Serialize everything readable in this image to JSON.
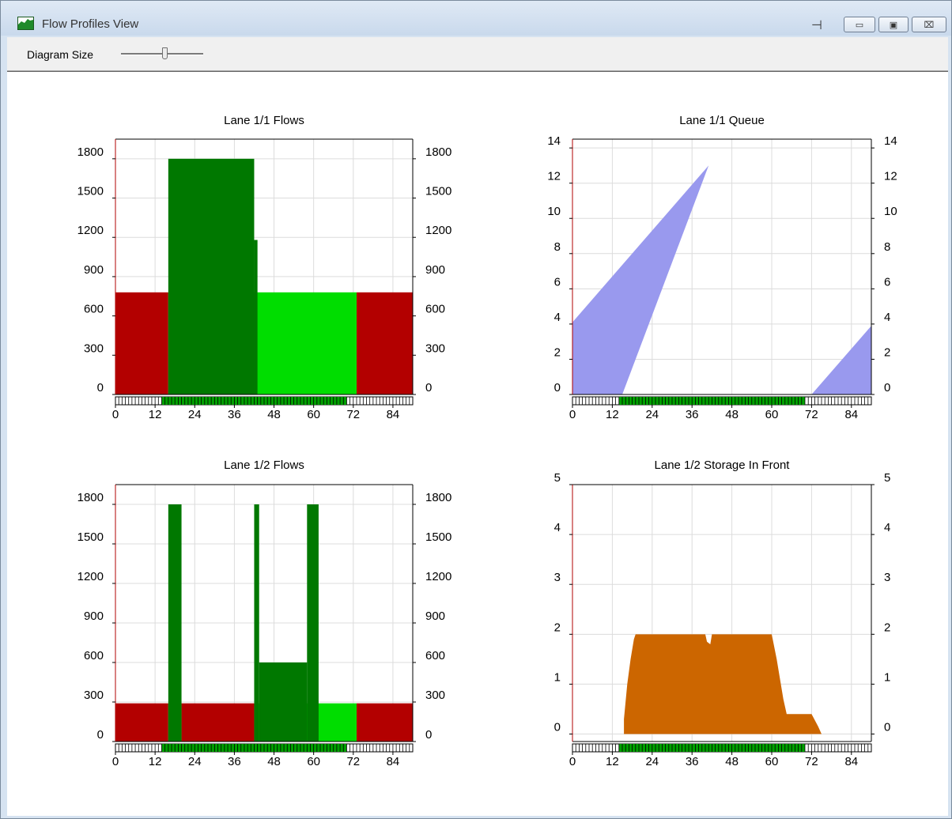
{
  "window": {
    "title": "Flow Profiles View"
  },
  "titlebar": {
    "pin_glyph": "⊣",
    "minimize_glyph": "▭",
    "maximize_glyph": "▣",
    "close_glyph": "⌧"
  },
  "toolbar": {
    "diagram_size_label": "Diagram Size",
    "diagram_size_value": 0.55
  },
  "chart_data": [
    {
      "type": "bar",
      "title": "Lane 1/1 Flows",
      "ylim": [
        0,
        1950
      ],
      "yticks": [
        0,
        300,
        600,
        900,
        1200,
        1500,
        1800
      ],
      "xlim": [
        0,
        90
      ],
      "xticks": [
        0,
        12,
        24,
        36,
        48,
        60,
        72,
        84
      ],
      "signal": [
        {
          "from": 0,
          "to": 14,
          "state": "red"
        },
        {
          "from": 14,
          "to": 70,
          "state": "green"
        },
        {
          "from": 70,
          "to": 90,
          "state": "red"
        }
      ],
      "series": [
        {
          "color": "#b30000",
          "segments": [
            {
              "from": 0,
              "to": 16,
              "value": 780
            },
            {
              "from": 73,
              "to": 90,
              "value": 780
            }
          ]
        },
        {
          "color": "#00dd00",
          "segments": [
            {
              "from": 16,
              "to": 73,
              "value": 780
            }
          ]
        },
        {
          "color": "#007800",
          "segments": [
            {
              "from": 16,
              "to": 42,
              "value": 1800
            },
            {
              "from": 42,
              "to": 43,
              "value": 1180
            }
          ]
        }
      ]
    },
    {
      "type": "area",
      "title": "Lane 1/1 Queue",
      "ylim": [
        0,
        14.5
      ],
      "yticks": [
        0,
        2,
        4,
        6,
        8,
        10,
        12,
        14
      ],
      "xlim": [
        0,
        90
      ],
      "xticks": [
        0,
        12,
        24,
        36,
        48,
        60,
        72,
        84
      ],
      "signal": [
        {
          "from": 0,
          "to": 14,
          "state": "red"
        },
        {
          "from": 14,
          "to": 70,
          "state": "green"
        },
        {
          "from": 70,
          "to": 90,
          "state": "red"
        }
      ],
      "series": [
        {
          "color": "#9999ee",
          "bands": [
            {
              "upper": [
                [
                  0,
                  4.1
                ],
                [
                  41,
                  13
                ]
              ],
              "lower": [
                [
                  0,
                  0
                ],
                [
                  15,
                  0
                ],
                [
                  41,
                  13
                ]
              ]
            },
            {
              "upper": [
                [
                  72,
                  0
                ],
                [
                  90,
                  3.9
                ]
              ],
              "lower": [
                [
                  72,
                  0
                ],
                [
                  90,
                  0
                ]
              ]
            }
          ]
        }
      ]
    },
    {
      "type": "bar",
      "title": "Lane 1/2 Flows",
      "ylim": [
        0,
        1950
      ],
      "yticks": [
        0,
        300,
        600,
        900,
        1200,
        1500,
        1800
      ],
      "xlim": [
        0,
        90
      ],
      "xticks": [
        0,
        12,
        24,
        36,
        48,
        60,
        72,
        84
      ],
      "signal": [
        {
          "from": 0,
          "to": 14,
          "state": "red"
        },
        {
          "from": 14,
          "to": 70,
          "state": "green"
        },
        {
          "from": 70,
          "to": 90,
          "state": "red"
        }
      ],
      "series": [
        {
          "color": "#b30000",
          "segments": [
            {
              "from": 0,
              "to": 16,
              "value": 290
            },
            {
              "from": 20,
              "to": 42,
              "value": 290
            },
            {
              "from": 73,
              "to": 90,
              "value": 290
            }
          ]
        },
        {
          "color": "#00dd00",
          "segments": [
            {
              "from": 16,
              "to": 20,
              "value": 290
            },
            {
              "from": 42,
              "to": 73,
              "value": 290
            }
          ]
        },
        {
          "color": "#007800",
          "segments": [
            {
              "from": 16,
              "to": 20,
              "value": 1800
            },
            {
              "from": 42,
              "to": 43.5,
              "value": 1800
            },
            {
              "from": 43.5,
              "to": 58,
              "value": 600
            },
            {
              "from": 58,
              "to": 61.5,
              "value": 1800
            }
          ]
        }
      ]
    },
    {
      "type": "area",
      "title": "Lane 1/2 Storage In Front",
      "ylim": [
        -0.15,
        5
      ],
      "yticks": [
        0,
        1,
        2,
        3,
        4,
        5
      ],
      "xlim": [
        0,
        90
      ],
      "xticks": [
        0,
        12,
        24,
        36,
        48,
        60,
        72,
        84
      ],
      "signal": [
        {
          "from": 0,
          "to": 14,
          "state": "red"
        },
        {
          "from": 14,
          "to": 70,
          "state": "green"
        },
        {
          "from": 70,
          "to": 90,
          "state": "red"
        }
      ],
      "series": [
        {
          "color": "#cc6600",
          "points": [
            [
              15.5,
              0.3
            ],
            [
              16.5,
              1
            ],
            [
              17.5,
              1.5
            ],
            [
              18.5,
              1.9
            ],
            [
              19,
              2
            ],
            [
              40,
              2
            ],
            [
              40.5,
              1.85
            ],
            [
              41.5,
              1.8
            ],
            [
              42,
              2
            ],
            [
              60,
              2
            ],
            [
              61.5,
              1.5
            ],
            [
              63.5,
              0.7
            ],
            [
              64.5,
              0.4
            ],
            [
              72,
              0.4
            ],
            [
              74,
              0.15
            ],
            [
              75,
              0
            ]
          ]
        }
      ]
    }
  ]
}
